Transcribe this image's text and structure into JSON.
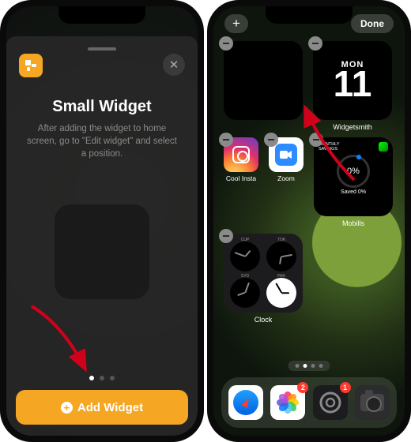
{
  "left": {
    "sheet_title": "Small Widget",
    "sheet_subtitle": "After adding the widget to home screen, go to \"Edit widget\" and select a position.",
    "add_button": "Add Widget",
    "page_index": 0,
    "page_count": 3,
    "app_icon": "widgetsmith-app-icon",
    "close_glyph": "✕"
  },
  "right": {
    "plus_label": "+",
    "done_label": "Done",
    "widgets": {
      "blank": {
        "label": ""
      },
      "calendar": {
        "day": "MON",
        "date": "11",
        "label": "Widgetsmith"
      },
      "mobills": {
        "header": "MONTHLY SAVINGS",
        "percent": "0%",
        "saved": "Saved 0%",
        "label": "Mobills"
      },
      "clock": {
        "label": "Clock",
        "faces": [
          {
            "city": "CUP",
            "theme": "dark",
            "h_angle": 40,
            "m_angle": 290
          },
          {
            "city": "TOK",
            "theme": "dark",
            "h_angle": 190,
            "m_angle": 80
          },
          {
            "city": "SYD",
            "theme": "dark",
            "h_angle": 250,
            "m_angle": 20
          },
          {
            "city": "PAR",
            "theme": "light",
            "h_angle": 90,
            "m_angle": 330
          }
        ]
      }
    },
    "apps": {
      "insta": {
        "label": "Cool Insta"
      },
      "zoom": {
        "label": "Zoom"
      }
    },
    "dock": {
      "safari": {
        "name": "Safari"
      },
      "photos": {
        "name": "Photos",
        "badge": "2"
      },
      "settings": {
        "name": "Settings",
        "badge": "1"
      },
      "camera": {
        "name": "Camera"
      }
    },
    "page_index": 1,
    "page_count": 4
  },
  "colors": {
    "accent": "#f5a623",
    "arrow": "#d0021b"
  }
}
